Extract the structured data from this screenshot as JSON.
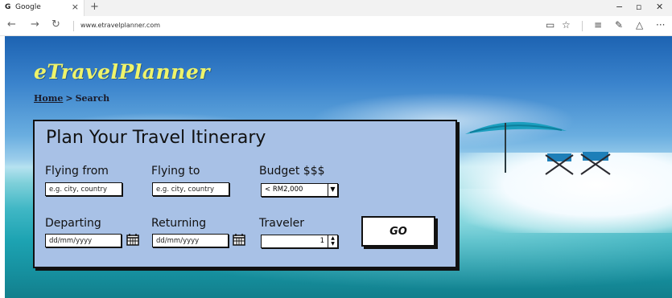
{
  "browser": {
    "tab_favicon": "G",
    "tab_title": "Google",
    "tab_close": "×",
    "new_tab": "+",
    "url": "www.etravelplanner.com",
    "icons": [
      "back-icon",
      "forward-icon",
      "refresh-icon",
      "reading-view-icon",
      "favorite-star-icon",
      "hub-icon",
      "web-note-icon",
      "share-icon",
      "more-icon"
    ]
  },
  "site": {
    "logo": "eTravelPlanner",
    "breadcrumb": {
      "home": "Home",
      "separator": ">",
      "current": "Search"
    }
  },
  "form": {
    "title": "Plan Your Travel Itinerary",
    "flying_from": {
      "label": "Flying from",
      "placeholder": "e.g. city, country"
    },
    "flying_to": {
      "label": "Flying to",
      "placeholder": "e.g. city, country"
    },
    "budget": {
      "label": "Budget $$$",
      "value": "< RM2,000"
    },
    "departing": {
      "label": "Departing",
      "placeholder": "dd/mm/yyyy"
    },
    "returning": {
      "label": "Returning",
      "placeholder": "dd/mm/yyyy"
    },
    "traveler": {
      "label": "Traveler",
      "value": "1"
    },
    "go_label": "GO"
  }
}
